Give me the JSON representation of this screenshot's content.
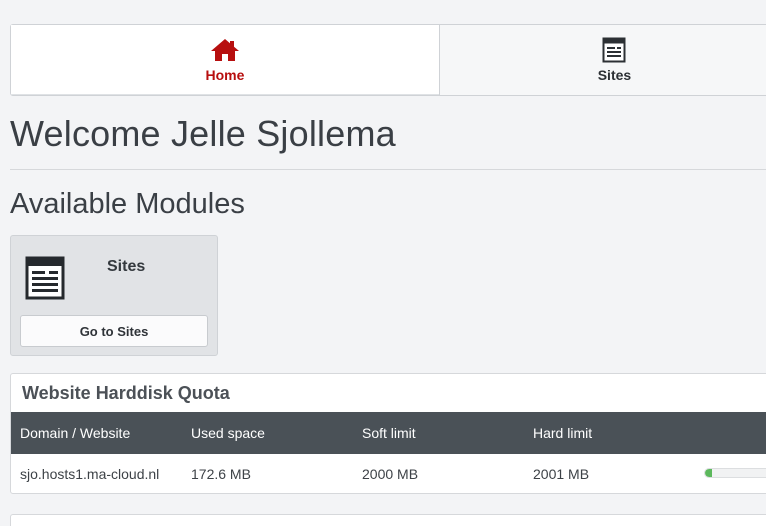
{
  "nav": {
    "tabs": [
      {
        "label": "Home",
        "icon": "home-icon",
        "active": true
      },
      {
        "label": "Sites",
        "icon": "browser-window-icon",
        "active": false
      }
    ]
  },
  "welcome": "Welcome Jelle Sjollema",
  "modules": {
    "title": "Available Modules",
    "items": [
      {
        "name": "Sites",
        "icon": "browser-window-icon",
        "button": "Go to Sites"
      }
    ]
  },
  "quota": {
    "title": "Website Harddisk Quota",
    "columns": [
      "Domain / Website",
      "Used space",
      "Soft limit",
      "Hard limit"
    ],
    "rows": [
      {
        "domain": "sjo.hosts1.ma-cloud.nl",
        "used": "172.6 MB",
        "soft": "2000 MB",
        "hard": "2001 MB",
        "usage_fraction": 0.086
      }
    ]
  },
  "colors": {
    "accent_red": "#b70f0f",
    "table_header": "#4a5157",
    "progress_green": "#5cb85c"
  }
}
